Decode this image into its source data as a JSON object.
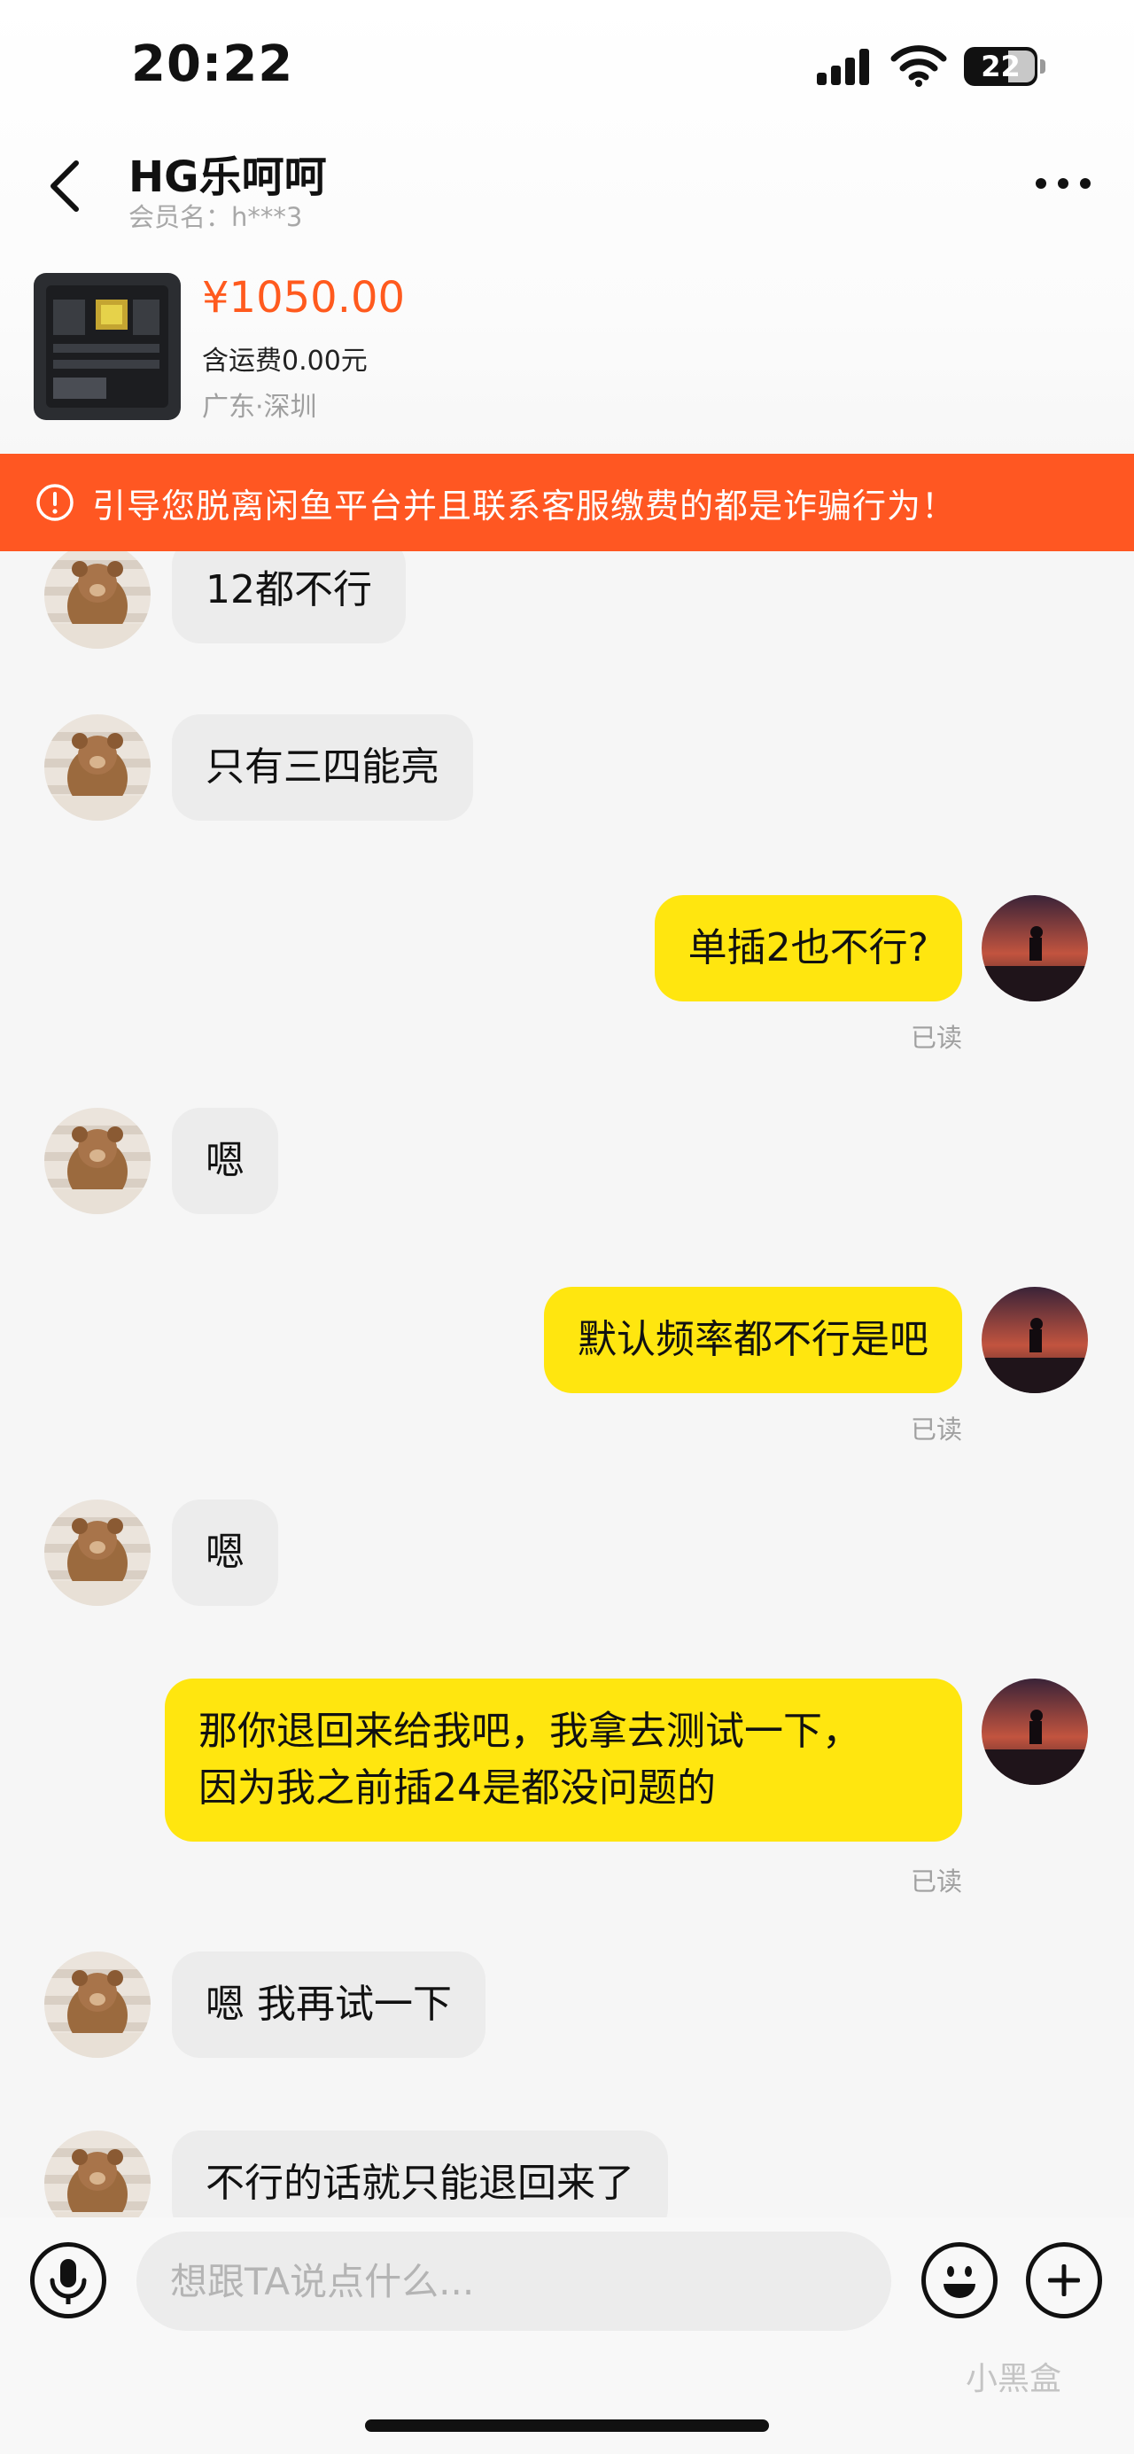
{
  "status_bar": {
    "time": "20:22",
    "battery": "22"
  },
  "header": {
    "seller_name": "HG乐呵呵",
    "member_name": "会员名：h***3"
  },
  "product": {
    "price": "¥1050.00",
    "shipping": "含运费0.00元",
    "location": "广东·深圳"
  },
  "warning": {
    "text": "引导您脱离闲鱼平台并且联系客服缴费的都是诈骗行为！"
  },
  "messages": [
    {
      "side": "in",
      "text": "12都不行"
    },
    {
      "side": "in",
      "text": "只有三四能亮"
    },
    {
      "side": "out",
      "text": "单插2也不行?",
      "read": "已读"
    },
    {
      "side": "in",
      "text": "嗯"
    },
    {
      "side": "out",
      "text": "默认频率都不行是吧",
      "read": "已读"
    },
    {
      "side": "in",
      "text": "嗯"
    },
    {
      "side": "out",
      "lines": [
        "那你退回来给我吧，我拿去测试一下，",
        "因为我之前插24是都没问题的"
      ],
      "read": "已读"
    },
    {
      "side": "in",
      "text": "嗯 我再试一下"
    },
    {
      "side": "in",
      "text": "不行的话就只能退回来了"
    }
  ],
  "input": {
    "placeholder": "想跟TA说点什么..."
  },
  "watermark": "小黑盒",
  "colors": {
    "accent_orange": "#ff5722",
    "price_orange": "#ff5a1e",
    "outgoing_bubble": "#ffe60f",
    "incoming_bubble": "#ececec"
  },
  "icons": [
    "back-icon",
    "more-icon",
    "warning-icon",
    "mic-icon",
    "emoji-icon",
    "plus-icon",
    "signal-icon",
    "wifi-icon"
  ]
}
